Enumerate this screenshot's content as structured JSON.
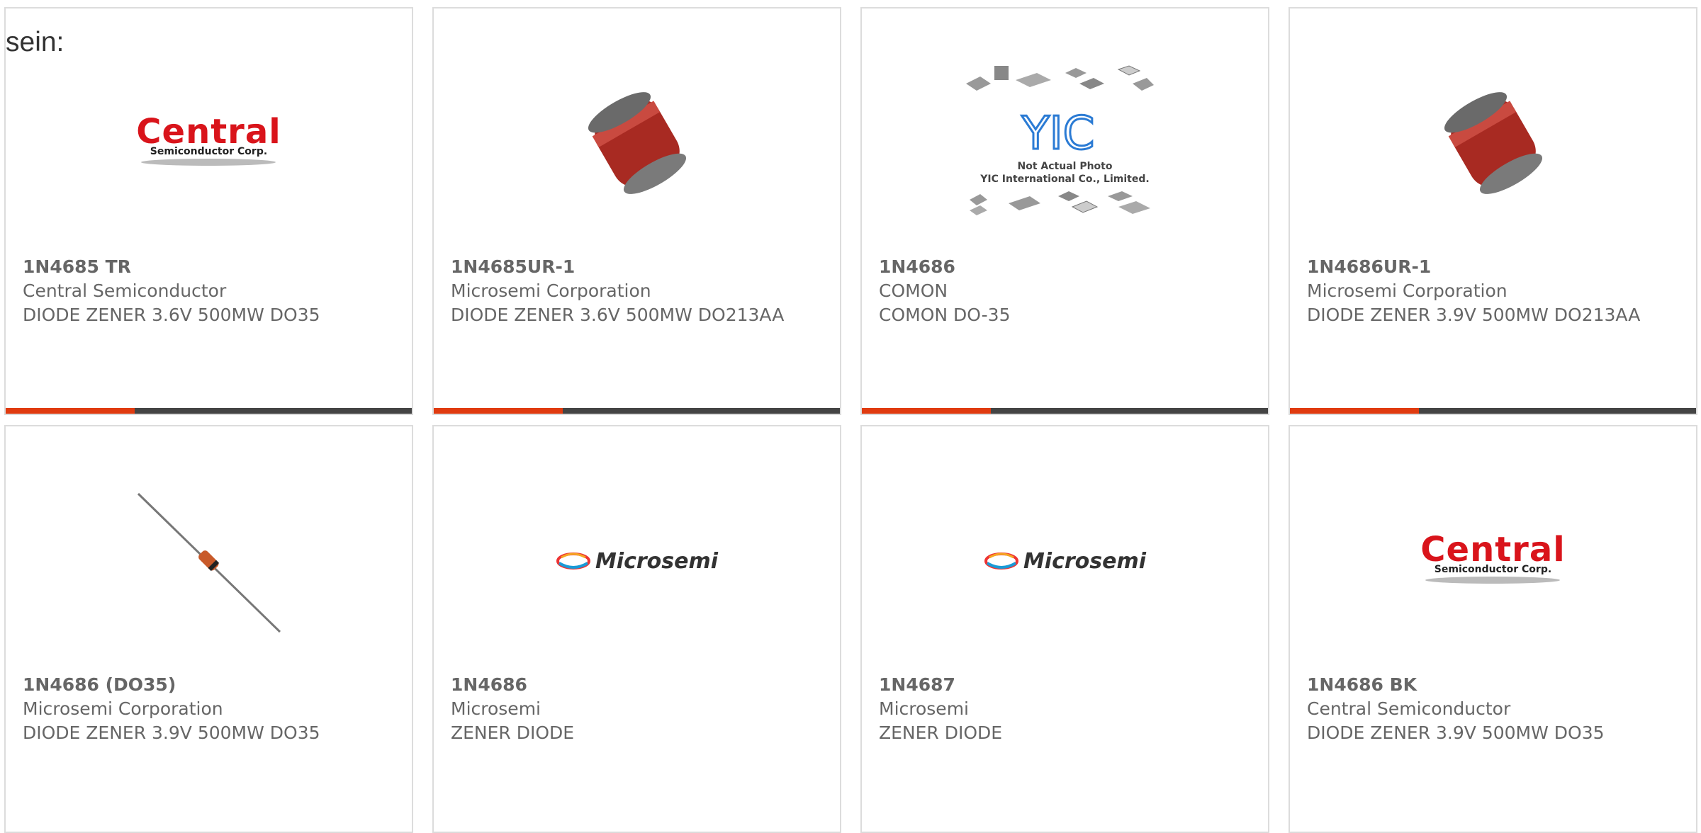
{
  "header_fragment": "sein:",
  "colors": {
    "accent": "#e03b10",
    "bar": "#444444",
    "border": "#dcdcdc",
    "text": "#666666"
  },
  "products": [
    {
      "part": "1N4685 TR",
      "manufacturer": "Central Semiconductor",
      "description": "DIODE ZENER 3.6V 500MW DO35",
      "image": "central-logo"
    },
    {
      "part": "1N4685UR-1",
      "manufacturer": "Microsemi Corporation",
      "description": "DIODE ZENER 3.6V 500MW DO213AA",
      "image": "melf-diode"
    },
    {
      "part": "1N4686",
      "manufacturer": "COMON",
      "description": "COMON DO-35",
      "image": "yic-placeholder"
    },
    {
      "part": "1N4686UR-1",
      "manufacturer": "Microsemi Corporation",
      "description": "DIODE ZENER 3.9V 500MW DO213AA",
      "image": "melf-diode"
    },
    {
      "part": "1N4686 (DO35)",
      "manufacturer": "Microsemi Corporation",
      "description": "DIODE ZENER 3.9V 500MW DO35",
      "image": "axial-diode"
    },
    {
      "part": "1N4686",
      "manufacturer": "Microsemi",
      "description": "ZENER DIODE",
      "image": "microsemi-logo"
    },
    {
      "part": "1N4687",
      "manufacturer": "Microsemi",
      "description": "ZENER DIODE",
      "image": "microsemi-logo"
    },
    {
      "part": "1N4686 BK",
      "manufacturer": "Central Semiconductor",
      "description": "DIODE ZENER 3.9V 500MW DO35",
      "image": "central-logo"
    }
  ],
  "logos": {
    "central_main": "Central",
    "central_sub": "Semiconductor Corp.",
    "microsemi": "Microsemi",
    "yic_mark": "YIC",
    "yic_line1": "Not Actual Photo",
    "yic_line2": "YIC International Co., Limited."
  }
}
